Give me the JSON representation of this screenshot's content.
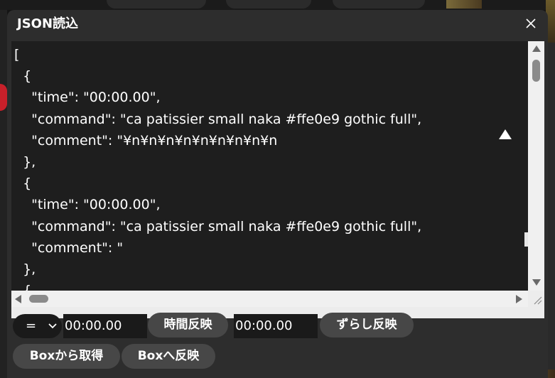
{
  "dialog": {
    "title": "JSON読込"
  },
  "editor": {
    "lines": [
      "[",
      "  {",
      "    \"time\": \"00:00.00\",",
      "    \"command\": \"ca patissier small naka #ffe0e9 gothic full\",",
      "    \"comment\": \"¥n¥n¥n¥n¥n¥n¥n¥n¥n",
      "  },",
      "  {",
      "    \"time\": \"00:00.00\",",
      "    \"command\": \"ca patissier small naka #ffe0e9 gothic full\",",
      "    \"comment\": \"",
      "  },",
      "  {"
    ]
  },
  "controls": {
    "operator_select": {
      "value": "="
    },
    "time_input_1": {
      "value": "00:00.00"
    },
    "apply_time_button": "時間反映",
    "time_input_2": {
      "value": "00:00.00"
    },
    "shift_apply_button": "ずらし反映",
    "get_from_box_button": "Boxから取得",
    "apply_to_box_button": "Boxへ反映"
  },
  "colors": {
    "dialog_bg": "#2d2d2d",
    "editor_bg": "#1e1e1e",
    "button_bg": "#474747",
    "input_bg": "#1a1a1a",
    "text": "#ffffff"
  }
}
